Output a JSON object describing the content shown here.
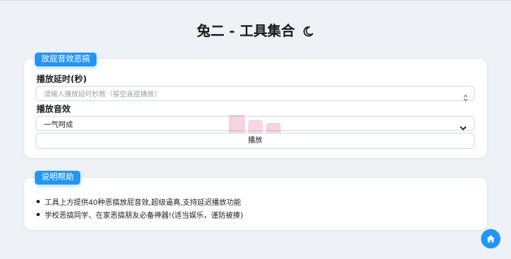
{
  "header": {
    "title": "兔二 - 工具集合"
  },
  "prank_card": {
    "badge": "放屁音效恶搞",
    "delay_label": "播放延时(秒)",
    "delay_placeholder": "请输入播放延时秒数（留空直接播放）",
    "sound_label": "播放音效",
    "sound_selected": "一气呵成",
    "play_button": "播放"
  },
  "help_card": {
    "badge": "说明帮助",
    "items": [
      "工具上方提供40种恶搞放屁音效,超级逼真,支持延迟播放功能",
      "学校恶搞同学、在家恶搞朋友必备神器!(适当娱乐，谨防被揍)"
    ]
  },
  "icons": {
    "title_icon": "crescent-moon-icon",
    "spinner": "number-spinner-icon",
    "dropdown": "chevron-down-icon",
    "home": "home-icon"
  },
  "colors": {
    "accent": "#2196f3",
    "background": "#eef1f5"
  }
}
